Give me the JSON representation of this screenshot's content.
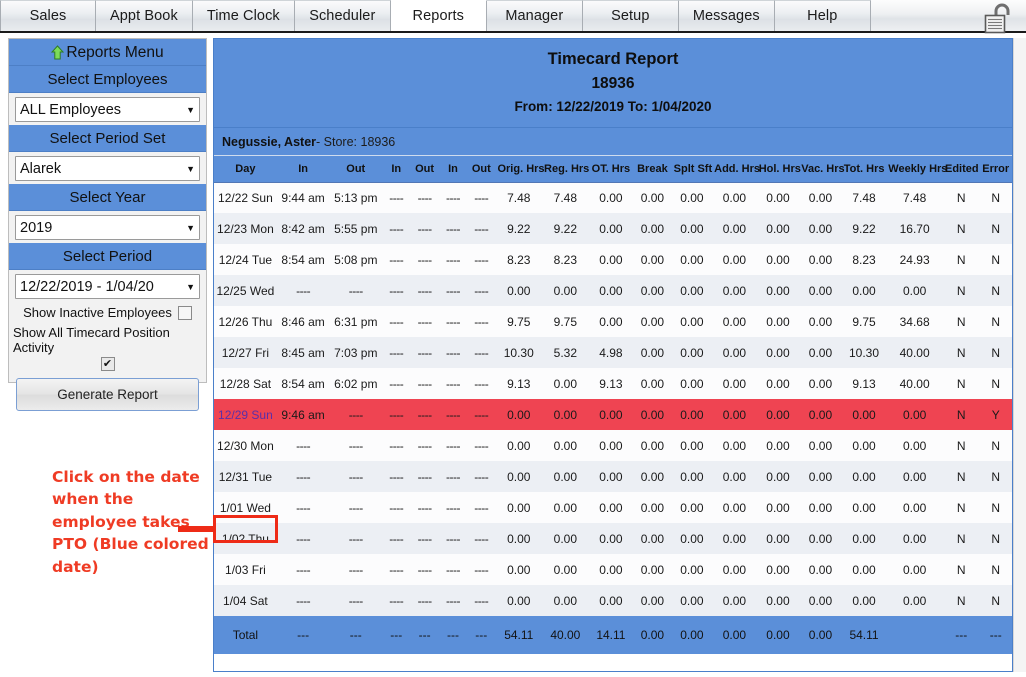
{
  "topbar": {
    "tabs": [
      {
        "label": "Sales",
        "active": false
      },
      {
        "label": "Appt Book",
        "active": false
      },
      {
        "label": "Time Clock",
        "active": false
      },
      {
        "label": "Scheduler",
        "active": false
      },
      {
        "label": "Reports",
        "active": true
      },
      {
        "label": "Manager",
        "active": false
      },
      {
        "label": "Setup",
        "active": false
      },
      {
        "label": "Messages",
        "active": false
      },
      {
        "label": "Help",
        "active": false
      }
    ],
    "lock_icon": "unlocked-padlock-icon"
  },
  "sidebar": {
    "menu_label": "Reports Menu",
    "menu_icon": "green-up-arrow-icon",
    "sections": [
      {
        "band": "Select Employees",
        "value": "ALL Employees"
      },
      {
        "band": "Select Period Set",
        "value": "Alarek"
      },
      {
        "band": "Select Year",
        "value": "2019"
      },
      {
        "band": "Select Period",
        "value": "12/22/2019 - 1/04/20"
      }
    ],
    "show_inactive_label": "Show Inactive Employees",
    "show_inactive_checked": false,
    "show_all_activity_label": "Show All Timecard Position Activity",
    "show_all_activity_checked": true,
    "generate_label": "Generate Report",
    "caret": "▼",
    "check_glyph": "✔"
  },
  "annotation": {
    "text": "Click on the date when the employee takes PTO (Blue colored date)",
    "color": "#ef3b24",
    "arrow_icon": "right-arrow-icon"
  },
  "report": {
    "title": "Timecard Report",
    "store_id": "18936",
    "date_range": "From: 12/22/2019 To: 1/04/2020",
    "employee_name": "Negussie, Aster",
    "employee_store": " - Store: 18936",
    "accent_color": "#5b8fd9",
    "error_row_color": "#ef4452",
    "day_link_color": "#2e3ea8",
    "columns": [
      "Day",
      "In",
      "Out",
      "In",
      "Out",
      "In",
      "Out",
      "Orig. Hrs",
      "Reg. Hrs",
      "OT. Hrs",
      "Break",
      "Splt Sft",
      "Add. Hrs",
      "Hol. Hrs",
      "Vac. Hrs",
      "Tot. Hrs",
      "Weekly Hrs",
      "Edited",
      "Error"
    ],
    "rows": [
      {
        "day": "12/22 Sun",
        "in1": "9:44 am",
        "out1": "5:13 pm",
        "in2": "----",
        "out2": "----",
        "in3": "----",
        "out3": "----",
        "orig": "7.48",
        "reg": "7.48",
        "ot": "0.00",
        "brk": "0.00",
        "splt": "0.00",
        "add": "0.00",
        "hol": "0.00",
        "vac": "0.00",
        "tot": "7.48",
        "weekly": "7.48",
        "edited": "N",
        "error": "N",
        "err_row": false
      },
      {
        "day": "12/23 Mon",
        "in1": "8:42 am",
        "out1": "5:55 pm",
        "in2": "----",
        "out2": "----",
        "in3": "----",
        "out3": "----",
        "orig": "9.22",
        "reg": "9.22",
        "ot": "0.00",
        "brk": "0.00",
        "splt": "0.00",
        "add": "0.00",
        "hol": "0.00",
        "vac": "0.00",
        "tot": "9.22",
        "weekly": "16.70",
        "edited": "N",
        "error": "N",
        "err_row": false
      },
      {
        "day": "12/24 Tue",
        "in1": "8:54 am",
        "out1": "5:08 pm",
        "in2": "----",
        "out2": "----",
        "in3": "----",
        "out3": "----",
        "orig": "8.23",
        "reg": "8.23",
        "ot": "0.00",
        "brk": "0.00",
        "splt": "0.00",
        "add": "0.00",
        "hol": "0.00",
        "vac": "0.00",
        "tot": "8.23",
        "weekly": "24.93",
        "edited": "N",
        "error": "N",
        "err_row": false
      },
      {
        "day": "12/25 Wed",
        "in1": "----",
        "out1": "----",
        "in2": "----",
        "out2": "----",
        "in3": "----",
        "out3": "----",
        "orig": "0.00",
        "reg": "0.00",
        "ot": "0.00",
        "brk": "0.00",
        "splt": "0.00",
        "add": "0.00",
        "hol": "0.00",
        "vac": "0.00",
        "tot": "0.00",
        "weekly": "0.00",
        "edited": "N",
        "error": "N",
        "err_row": false
      },
      {
        "day": "12/26 Thu",
        "in1": "8:46 am",
        "out1": "6:31 pm",
        "in2": "----",
        "out2": "----",
        "in3": "----",
        "out3": "----",
        "orig": "9.75",
        "reg": "9.75",
        "ot": "0.00",
        "brk": "0.00",
        "splt": "0.00",
        "add": "0.00",
        "hol": "0.00",
        "vac": "0.00",
        "tot": "9.75",
        "weekly": "34.68",
        "edited": "N",
        "error": "N",
        "err_row": false
      },
      {
        "day": "12/27 Fri",
        "in1": "8:45 am",
        "out1": "7:03 pm",
        "in2": "----",
        "out2": "----",
        "in3": "----",
        "out3": "----",
        "orig": "10.30",
        "reg": "5.32",
        "ot": "4.98",
        "brk": "0.00",
        "splt": "0.00",
        "add": "0.00",
        "hol": "0.00",
        "vac": "0.00",
        "tot": "10.30",
        "weekly": "40.00",
        "edited": "N",
        "error": "N",
        "err_row": false
      },
      {
        "day": "12/28 Sat",
        "in1": "8:54 am",
        "out1": "6:02 pm",
        "in2": "----",
        "out2": "----",
        "in3": "----",
        "out3": "----",
        "orig": "9.13",
        "reg": "0.00",
        "ot": "9.13",
        "brk": "0.00",
        "splt": "0.00",
        "add": "0.00",
        "hol": "0.00",
        "vac": "0.00",
        "tot": "9.13",
        "weekly": "40.00",
        "edited": "N",
        "error": "N",
        "err_row": false
      },
      {
        "day": "12/29 Sun",
        "in1": "9:46 am",
        "out1": "----",
        "in2": "----",
        "out2": "----",
        "in3": "----",
        "out3": "----",
        "orig": "0.00",
        "reg": "0.00",
        "ot": "0.00",
        "brk": "0.00",
        "splt": "0.00",
        "add": "0.00",
        "hol": "0.00",
        "vac": "0.00",
        "tot": "0.00",
        "weekly": "0.00",
        "edited": "N",
        "error": "Y",
        "err_row": true
      },
      {
        "day": "12/30 Mon",
        "in1": "----",
        "out1": "----",
        "in2": "----",
        "out2": "----",
        "in3": "----",
        "out3": "----",
        "orig": "0.00",
        "reg": "0.00",
        "ot": "0.00",
        "brk": "0.00",
        "splt": "0.00",
        "add": "0.00",
        "hol": "0.00",
        "vac": "0.00",
        "tot": "0.00",
        "weekly": "0.00",
        "edited": "N",
        "error": "N",
        "err_row": false
      },
      {
        "day": "12/31 Tue",
        "in1": "----",
        "out1": "----",
        "in2": "----",
        "out2": "----",
        "in3": "----",
        "out3": "----",
        "orig": "0.00",
        "reg": "0.00",
        "ot": "0.00",
        "brk": "0.00",
        "splt": "0.00",
        "add": "0.00",
        "hol": "0.00",
        "vac": "0.00",
        "tot": "0.00",
        "weekly": "0.00",
        "edited": "N",
        "error": "N",
        "err_row": false
      },
      {
        "day": "1/01 Wed",
        "in1": "----",
        "out1": "----",
        "in2": "----",
        "out2": "----",
        "in3": "----",
        "out3": "----",
        "orig": "0.00",
        "reg": "0.00",
        "ot": "0.00",
        "brk": "0.00",
        "splt": "0.00",
        "add": "0.00",
        "hol": "0.00",
        "vac": "0.00",
        "tot": "0.00",
        "weekly": "0.00",
        "edited": "N",
        "error": "N",
        "err_row": false
      },
      {
        "day": "1/02 Thu",
        "in1": "----",
        "out1": "----",
        "in2": "----",
        "out2": "----",
        "in3": "----",
        "out3": "----",
        "orig": "0.00",
        "reg": "0.00",
        "ot": "0.00",
        "brk": "0.00",
        "splt": "0.00",
        "add": "0.00",
        "hol": "0.00",
        "vac": "0.00",
        "tot": "0.00",
        "weekly": "0.00",
        "edited": "N",
        "error": "N",
        "err_row": false
      },
      {
        "day": "1/03 Fri",
        "in1": "----",
        "out1": "----",
        "in2": "----",
        "out2": "----",
        "in3": "----",
        "out3": "----",
        "orig": "0.00",
        "reg": "0.00",
        "ot": "0.00",
        "brk": "0.00",
        "splt": "0.00",
        "add": "0.00",
        "hol": "0.00",
        "vac": "0.00",
        "tot": "0.00",
        "weekly": "0.00",
        "edited": "N",
        "error": "N",
        "err_row": false
      },
      {
        "day": "1/04 Sat",
        "in1": "----",
        "out1": "----",
        "in2": "----",
        "out2": "----",
        "in3": "----",
        "out3": "----",
        "orig": "0.00",
        "reg": "0.00",
        "ot": "0.00",
        "brk": "0.00",
        "splt": "0.00",
        "add": "0.00",
        "hol": "0.00",
        "vac": "0.00",
        "tot": "0.00",
        "weekly": "0.00",
        "edited": "N",
        "error": "N",
        "err_row": false
      }
    ],
    "total_row": {
      "day": "Total",
      "in1": "---",
      "out1": "---",
      "in2": "---",
      "out2": "---",
      "in3": "---",
      "out3": "---",
      "orig": "54.11",
      "reg": "40.00",
      "ot": "14.11",
      "brk": "0.00",
      "splt": "0.00",
      "add": "0.00",
      "hol": "0.00",
      "vac": "0.00",
      "tot": "54.11",
      "weekly": "",
      "edited": "---",
      "error": "---"
    }
  }
}
